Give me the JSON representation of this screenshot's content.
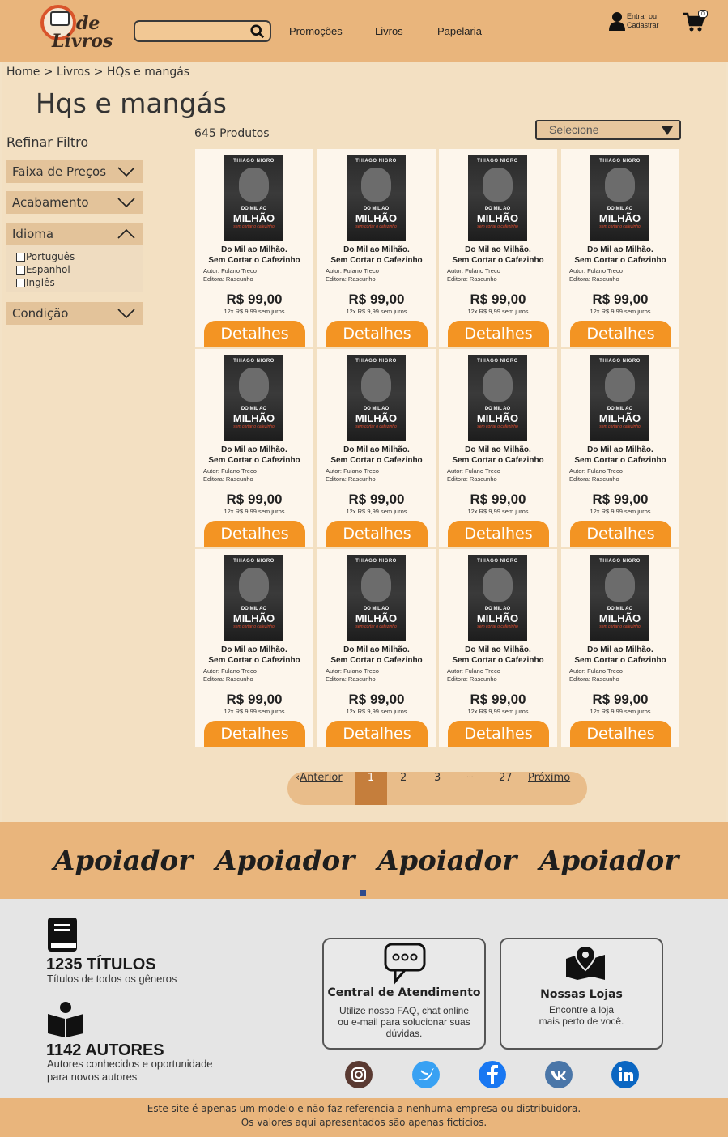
{
  "header": {
    "logo_text_top": "de",
    "logo_text_bottom": "Livros",
    "search_placeholder": "",
    "nav": [
      "Promoções",
      "Livros",
      "Papelaria"
    ],
    "login_line1": "Entrar ou",
    "login_line2": "Cadastrar",
    "cart_count": "0"
  },
  "breadcrumb": "Home > Livros > HQs e mangás",
  "page_title": "Hqs e mangás",
  "filters": {
    "title": "Refinar Filtro",
    "groups": [
      "Faixa de Preços",
      "Acabamento",
      "Idioma",
      "Condição"
    ],
    "languages": [
      "Português",
      "Espanhol",
      "Inglês"
    ]
  },
  "results": {
    "count": "645 Produtos",
    "sort_placeholder": "Selecione"
  },
  "product": {
    "cover_author": "THIAGO NIGRO",
    "cover_line1": "DO MIL AO",
    "cover_line2": "MILHÃO",
    "cover_line3": "sem cortar o cafezinho",
    "title_line1": "Do Mil ao Milhão.",
    "title_line2": "Sem Cortar o Cafezinho",
    "author": "Autor: Fulano Treco",
    "publisher": "Editora: Rascunho",
    "price": "R$ 99,00",
    "installments": "12x R$ 9,99 sem juros",
    "button": "Detalhes"
  },
  "pagination": {
    "prev": "Anterior",
    "pages": [
      "1",
      "2",
      "3",
      "...",
      "27"
    ],
    "next": "Próximo"
  },
  "sponsors": [
    "Apoiador",
    "Apoiador",
    "Apoiador",
    "Apoiador"
  ],
  "stats": {
    "titles_num": "1235 TÍTULOS",
    "titles_desc": "Títulos de todos os gêneros",
    "authors_num": "1142 AUTORES",
    "authors_desc1": "Autores conhecidos e oportunidade",
    "authors_desc2": "para novos autores"
  },
  "support": {
    "title": "Central de Atendimento",
    "desc1": "Utilize nosso FAQ, chat online",
    "desc2": "ou e-mail para solucionar suas",
    "desc3": "dúvidas."
  },
  "stores": {
    "title": "Nossas Lojas",
    "desc1": "Encontre a loja",
    "desc2": "mais perto de você."
  },
  "social": [
    "instagram-icon",
    "twitter-icon",
    "facebook-icon",
    "vk-icon",
    "linkedin-icon"
  ],
  "disclaimer": {
    "line1": "Este site é apenas um modelo e não faz referencia a nenhuma empresa ou distribuidora.",
    "line2": "Os valores aqui apresentados são apenas fictícios."
  },
  "colors": {
    "header": "#e9b57c",
    "button": "#f39423",
    "active_page": "#c57e3c"
  }
}
